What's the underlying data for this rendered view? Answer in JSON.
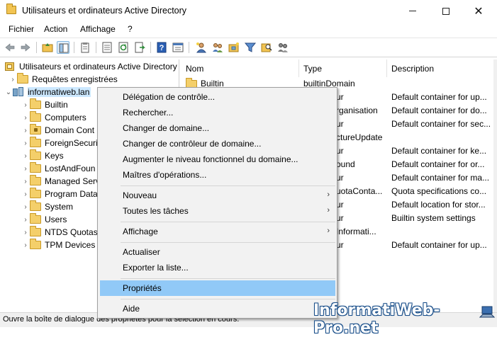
{
  "window": {
    "title": "Utilisateurs et ordinateurs Active Directory"
  },
  "menu": [
    "Fichier",
    "Action",
    "Affichage",
    "?"
  ],
  "tree": {
    "root": "Utilisateurs et ordinateurs Active Directory",
    "saved_queries": "Requêtes enregistrées",
    "domain": "informatiweb.lan",
    "children": [
      "Builtin",
      "Computers",
      "Domain Cont",
      "ForeignSecuri",
      "Keys",
      "LostAndFoun",
      "Managed Serv",
      "Program Data",
      "System",
      "Users",
      "NTDS Quotas",
      "TPM Devices"
    ]
  },
  "list": {
    "columns": [
      "Nom",
      "Type",
      "Description"
    ],
    "rows": [
      {
        "name": "Builtin",
        "type": "builtinDomain",
        "description": ""
      },
      {
        "name": "",
        "type": "ur",
        "description": "Default container for up..."
      },
      {
        "name": "",
        "type": "rganisation",
        "description": "Default container for do..."
      },
      {
        "name": "",
        "type": "ur",
        "description": "Default container for sec..."
      },
      {
        "name": "",
        "type": "ctureUpdate",
        "description": ""
      },
      {
        "name": "",
        "type": "ur",
        "description": "Default container for ke..."
      },
      {
        "name": "",
        "type": "ound",
        "description": "Default container for or..."
      },
      {
        "name": "",
        "type": "ur",
        "description": "Default container for ma..."
      },
      {
        "name": "",
        "type": "uotaConta...",
        "description": "Quota specifications co..."
      },
      {
        "name": "",
        "type": "ur",
        "description": "Default location for stor..."
      },
      {
        "name": "",
        "type": "ur",
        "description": "Builtin system settings"
      },
      {
        "name": "",
        "type": "Informati...",
        "description": ""
      },
      {
        "name": "",
        "type": "ur",
        "description": "Default container for up..."
      }
    ]
  },
  "context_menu": {
    "group1": [
      "Délégation de contrôle...",
      "Rechercher...",
      "Changer de domaine...",
      "Changer de contrôleur de domaine...",
      "Augmenter le niveau fonctionnel du domaine...",
      "Maîtres d'opérations..."
    ],
    "group2": [
      "Nouveau",
      "Toutes les tâches"
    ],
    "group3": [
      "Affichage"
    ],
    "group4": [
      "Actualiser",
      "Exporter la liste..."
    ],
    "group5": [
      "Propriétés"
    ],
    "group6": [
      "Aide"
    ],
    "highlighted": "Propriétés"
  },
  "status": "Ouvre la boîte de dialogue des propriétés pour la sélection en cours.",
  "watermark": "InformatiWeb-Pro.net"
}
